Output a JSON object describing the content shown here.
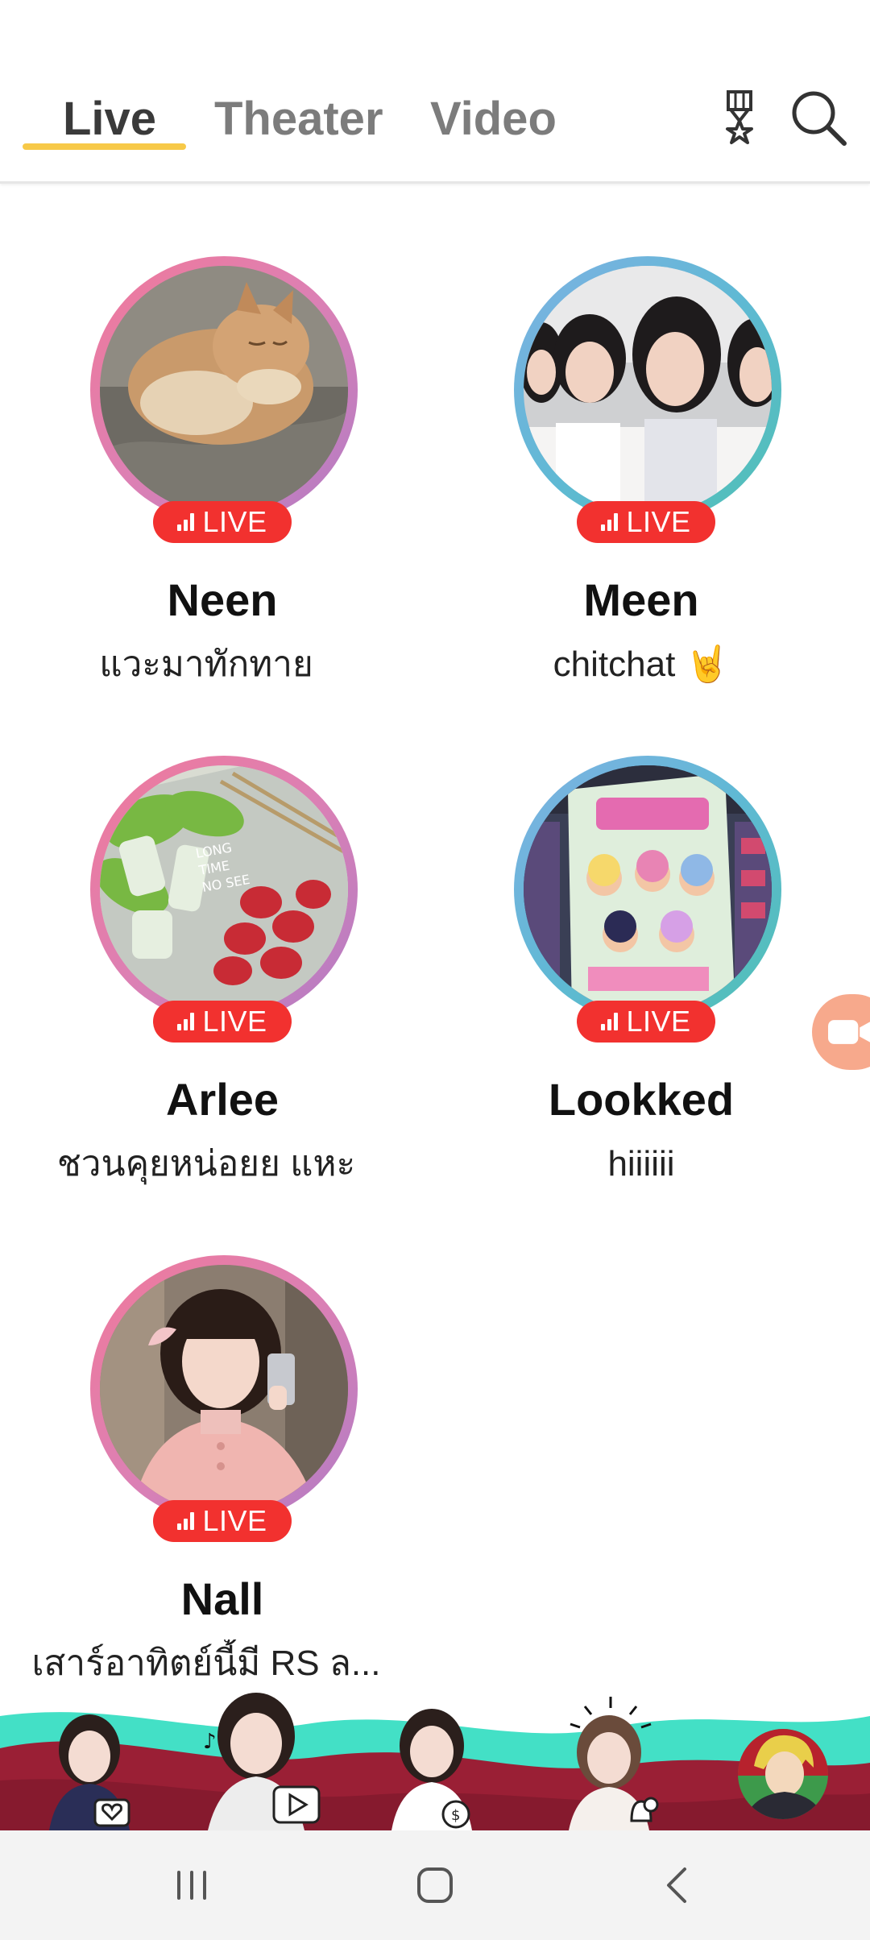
{
  "header": {
    "tabs": [
      {
        "label": "Live",
        "active": true
      },
      {
        "label": "Theater",
        "active": false
      },
      {
        "label": "Video",
        "active": false
      }
    ],
    "icons": [
      "medal-icon",
      "search-icon"
    ],
    "accent": "#f7c948"
  },
  "live_badge": "LIVE",
  "members": [
    {
      "name": "Neen",
      "caption": "แวะมาทักทาย",
      "ring": "pink"
    },
    {
      "name": "Meen",
      "caption": "chitchat 🤘",
      "ring": "blue"
    },
    {
      "name": "Arlee",
      "caption": "ชวนคุยหน่อยย แหะ",
      "ring": "pink"
    },
    {
      "name": "Lookked",
      "caption": "hiiiiii",
      "ring": "blue"
    },
    {
      "name": "Nall",
      "caption": "เสาร์อาทิตย์นี้มี RS ล...",
      "ring": "pink"
    }
  ],
  "colors": {
    "live": "#f2312f",
    "ring_pink": "#dc80b4",
    "ring_blue": "#5fb9d4",
    "fab": "#f7a98c",
    "banner_teal": "#43e0c6",
    "banner_red": "#9a1f35"
  },
  "banner": {
    "icons": [
      "heart-chat-icon",
      "play-video-icon",
      "coin-icon",
      "bell-check-icon",
      "anime-avatar"
    ]
  },
  "system_nav": [
    "recents-button",
    "home-button",
    "back-button"
  ]
}
